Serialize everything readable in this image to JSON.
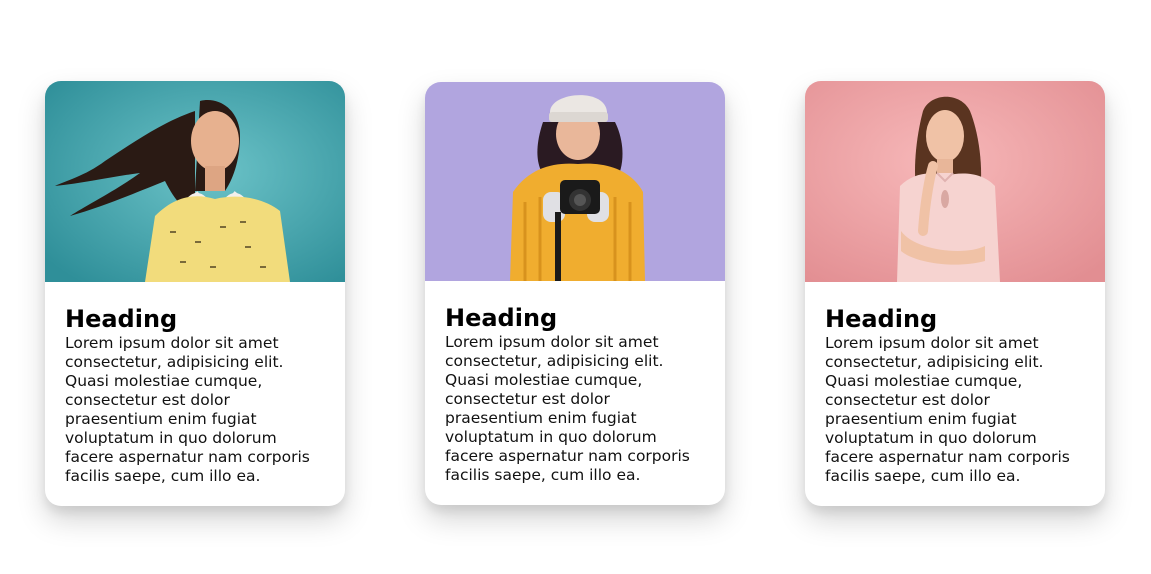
{
  "cards": [
    {
      "image_alt": "Woman with flowing hair and headphones on teal background",
      "background_color": "#3fa4ad",
      "heading": "Heading",
      "text": "Lorem ipsum dolor sit amet consectetur, adipisicing elit. Quasi molestiae cumque, consectetur est dolor praesentium enim fugiat voluptatum in quo dolorum facere aspernatur nam corporis facilis saepe, cum illo ea."
    },
    {
      "image_alt": "Woman in yellow sweater holding a camera on purple background",
      "background_color": "#b0a4dc",
      "heading": "Heading",
      "text": "Lorem ipsum dolor sit amet consectetur, adipisicing elit. Quasi molestiae cumque, consectetur est dolor praesentium enim fugiat voluptatum in quo dolorum facere aspernatur nam corporis facilis saepe, cum illo ea."
    },
    {
      "image_alt": "Woman in pink dress on pink background",
      "background_color": "#f0a8aa",
      "heading": "Heading",
      "text": "Lorem ipsum dolor sit amet consectetur, adipisicing elit. Quasi molestiae cumque, consectetur est dolor praesentium enim fugiat voluptatum in quo dolorum facere aspernatur nam corporis facilis saepe, cum illo ea."
    }
  ]
}
